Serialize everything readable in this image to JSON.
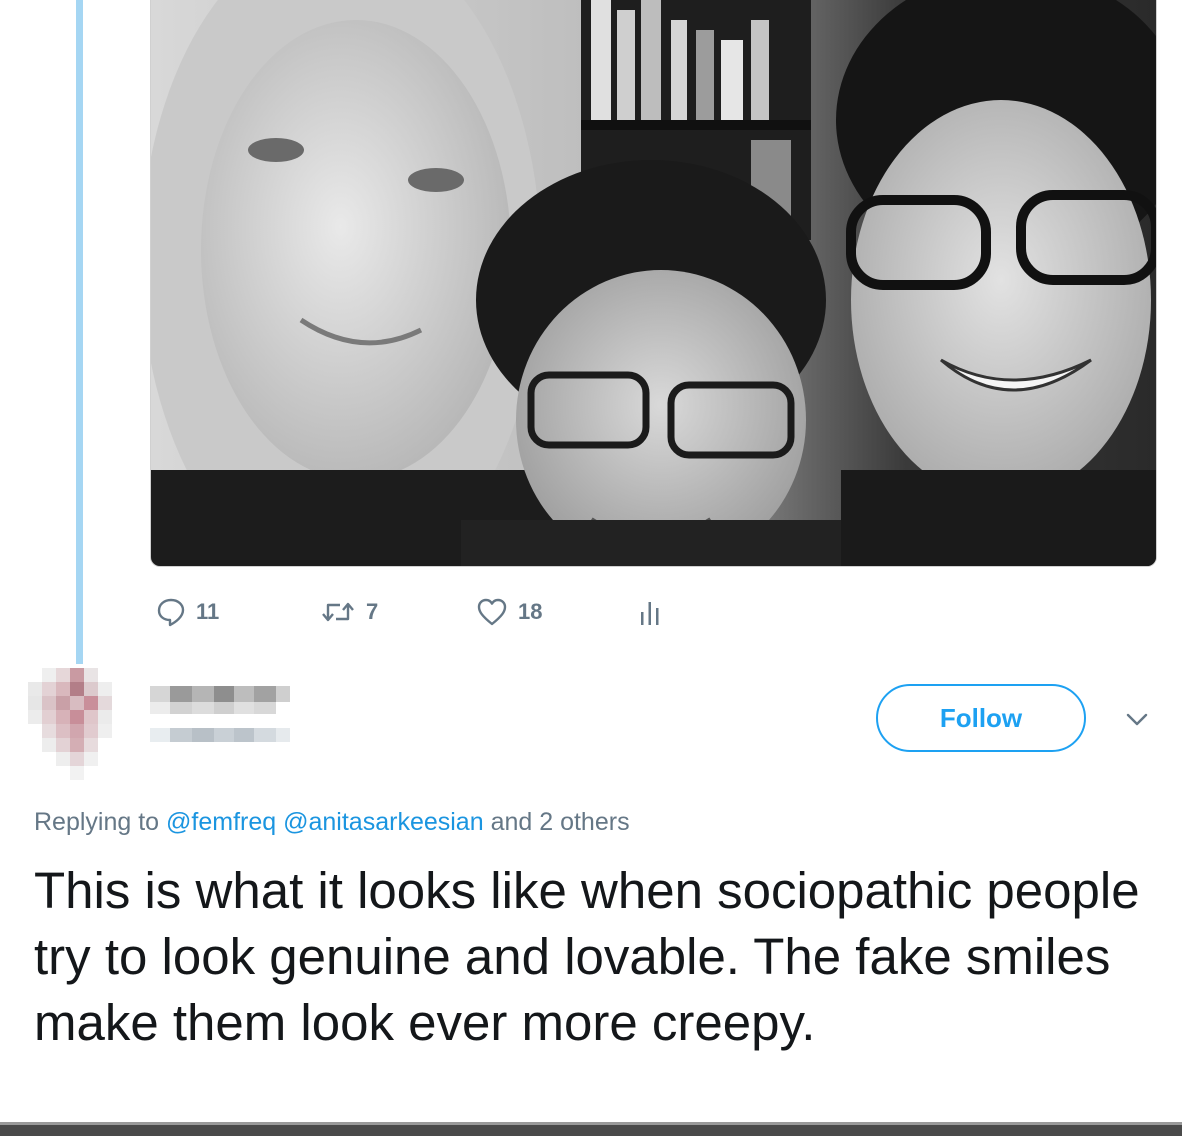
{
  "tweet_actions": {
    "reply_count": "11",
    "retweet_count": "7",
    "like_count": "18"
  },
  "reply_header": {
    "follow_label": "Follow"
  },
  "replying_to": {
    "prefix": "Replying to",
    "mention_1": "@femfreq",
    "mention_2": "@anitasarkeesian",
    "suffix": "and 2 others"
  },
  "tweet_body": {
    "text": "This is what it looks like when sociopathic people try to look genuine and lovable.  The fake smiles make them look ever more creepy."
  },
  "icons": {
    "reply": "reply-icon",
    "retweet": "retweet-icon",
    "like": "heart-icon",
    "analytics": "analytics-icon",
    "more": "chevron-down-icon"
  },
  "colors": {
    "accent": "#1da1f2",
    "mention": "#1b95e0",
    "thread_line": "#a5d6f3",
    "muted": "#657786"
  }
}
